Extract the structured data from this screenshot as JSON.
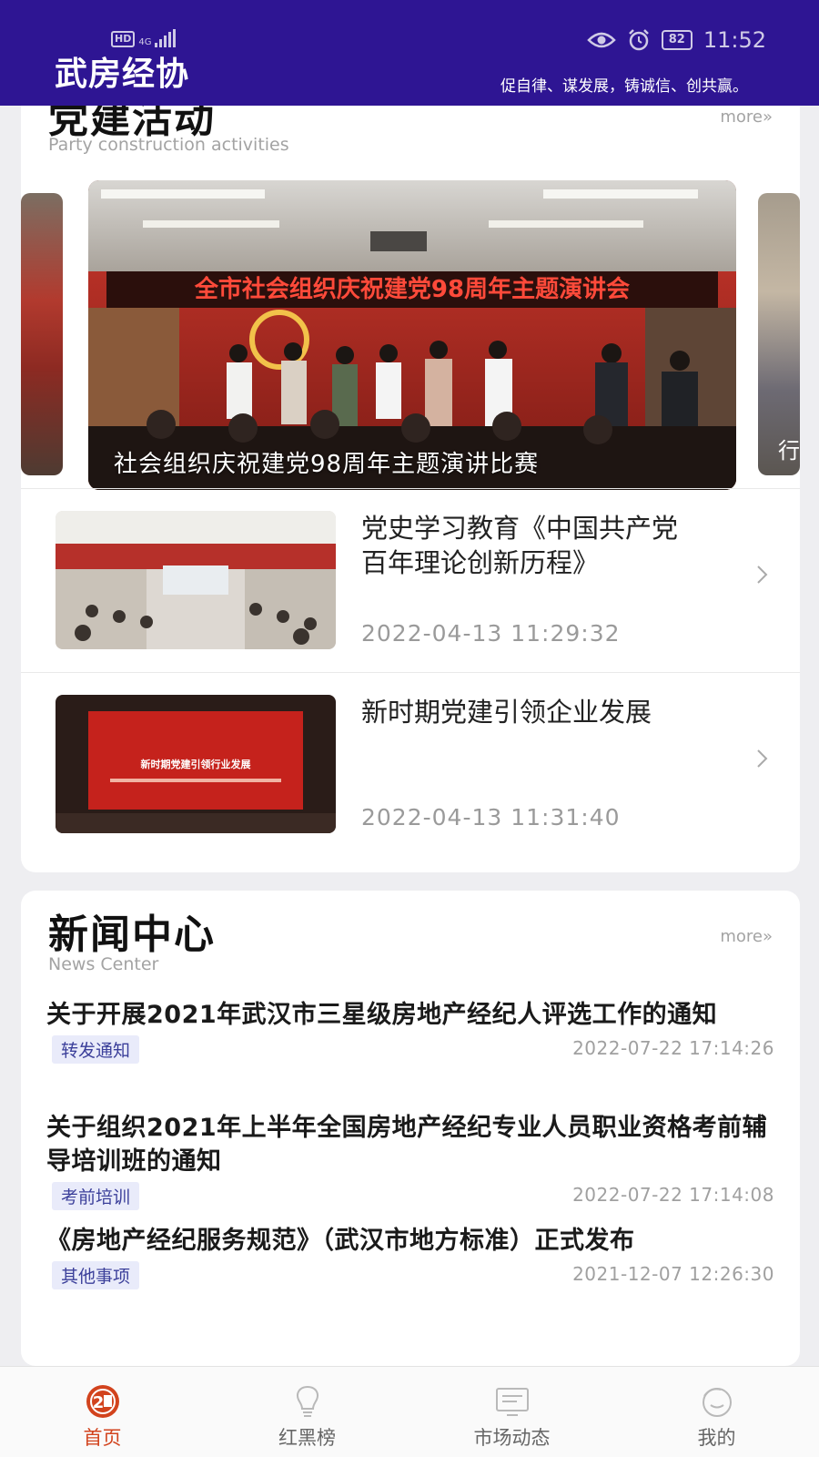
{
  "status_bar": {
    "network": "HD",
    "network_type": "4G",
    "battery": "82",
    "time": "11:52"
  },
  "header": {
    "logo": "武房经协",
    "slogan": "促自律、谋发展，铸诚信、创共赢。"
  },
  "party": {
    "title": "党建活动",
    "subtitle": "Party construction activities",
    "more": "more»",
    "carousel": {
      "banner_text": "全市社会组织庆祝建党98周年主题演讲会",
      "caption": "社会组织庆祝建党98周年主题演讲比赛",
      "next_peek": "行"
    },
    "articles": [
      {
        "title": "党史学习教育《中国共产党百年理论创新历程》",
        "date": "2022-04-13 11:29:32"
      },
      {
        "title": "新时期党建引领企业发展",
        "date": "2022-04-13 11:31:40",
        "thumb_text": "新时期党建引领行业发展"
      }
    ]
  },
  "news": {
    "title": "新闻中心",
    "subtitle": "News Center",
    "more": "more»",
    "items": [
      {
        "title": "关于开展2021年武汉市三星级房地产经纪人评选工作的通知",
        "tag": "转发通知",
        "date": "2022-07-22 17:14:26"
      },
      {
        "title": "关于组织2021年上半年全国房地产经纪专业人员职业资格考前辅导培训班的通知",
        "tag": "考前培训",
        "date": "2022-07-22 17:14:08"
      },
      {
        "title": "《房地产经纪服务规范》（武汉市地方标准）正式发布",
        "tag": "其他事项",
        "date": "2021-12-07 12:26:30"
      }
    ]
  },
  "tabbar": {
    "tabs": [
      {
        "label": "首页",
        "icon": "home-badge-icon",
        "active": true
      },
      {
        "label": "红黑榜",
        "icon": "lightbulb-icon",
        "active": false
      },
      {
        "label": "市场动态",
        "icon": "monitor-icon",
        "active": false
      },
      {
        "label": "我的",
        "icon": "face-icon",
        "active": false
      }
    ]
  },
  "colors": {
    "header_bg": "#2e1593",
    "active_tab": "#d2431d",
    "tag_bg": "#e9ebfa",
    "tag_text": "#3b3f9a"
  }
}
